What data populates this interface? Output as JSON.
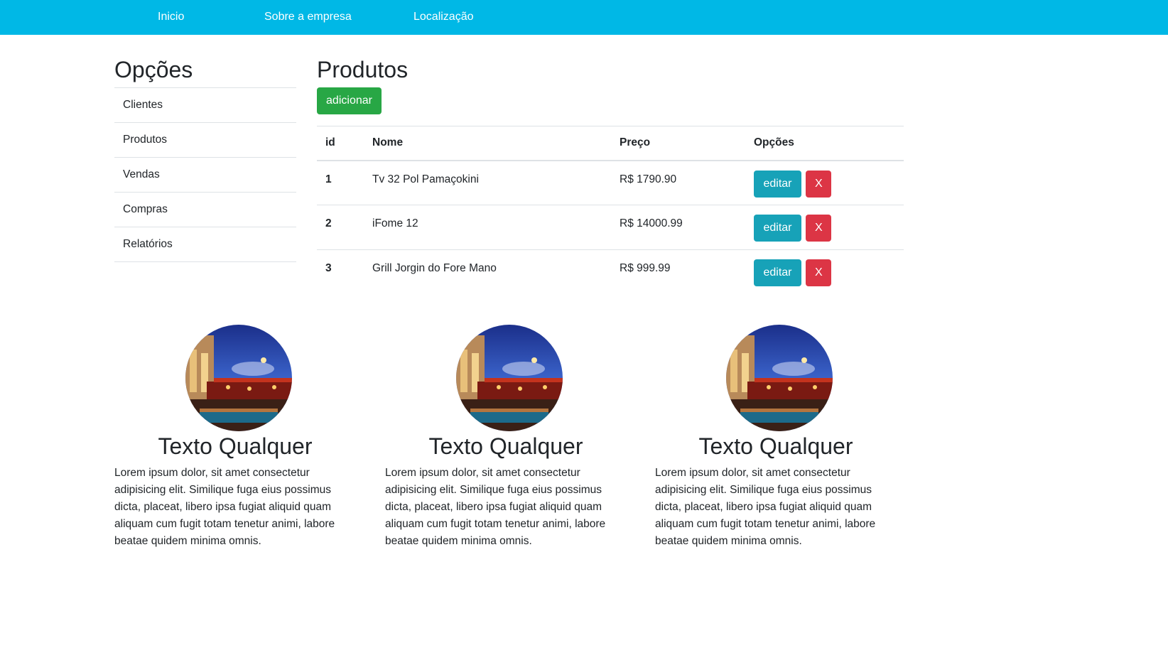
{
  "nav": {
    "items": [
      "Inicio",
      "Sobre a empresa",
      "Localização"
    ]
  },
  "sidebar": {
    "title": "Opções",
    "items": [
      "Clientes",
      "Produtos",
      "Vendas",
      "Compras",
      "Relatórios"
    ]
  },
  "main": {
    "title": "Produtos",
    "add_label": "adicionar",
    "table": {
      "headers": [
        "id",
        "Nome",
        "Preço",
        "Opções"
      ],
      "rows": [
        {
          "id": "1",
          "nome": "Tv 32 Pol Pamaçokini",
          "preco": "R$ 1790.90",
          "edit": "editar",
          "del": "X"
        },
        {
          "id": "2",
          "nome": "iFome 12",
          "preco": "R$ 14000.99",
          "edit": "editar",
          "del": "X"
        },
        {
          "id": "3",
          "nome": "Grill Jorgin do Fore Mano",
          "preco": "R$ 999.99",
          "edit": "editar",
          "del": "X"
        }
      ]
    }
  },
  "features": [
    {
      "title": "Texto Qualquer",
      "text": "Lorem ipsum dolor, sit amet consectetur adipisicing elit. Similique fuga eius possimus dicta, placeat, libero ipsa fugiat aliquid quam aliquam cum fugit totam tenetur animi, labore beatae quidem minima omnis."
    },
    {
      "title": "Texto Qualquer",
      "text": "Lorem ipsum dolor, sit amet consectetur adipisicing elit. Similique fuga eius possimus dicta, placeat, libero ipsa fugiat aliquid quam aliquam cum fugit totam tenetur animi, labore beatae quidem minima omnis."
    },
    {
      "title": "Texto Qualquer",
      "text": "Lorem ipsum dolor, sit amet consectetur adipisicing elit. Similique fuga eius possimus dicta, placeat, libero ipsa fugiat aliquid quam aliquam cum fugit totam tenetur animi, labore beatae quidem minima omnis."
    }
  ],
  "colors": {
    "navbar": "#00b8e6",
    "add_button": "#28a745",
    "edit_button": "#17a2b8",
    "delete_button": "#dc3545"
  }
}
